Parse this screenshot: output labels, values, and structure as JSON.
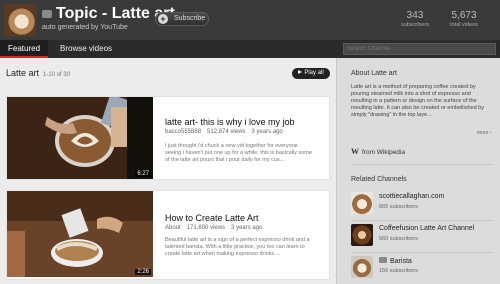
{
  "header": {
    "title": "Topic - Latte art",
    "subtitle": "auto generated by YouTube",
    "subscribe_label": "Subscribe",
    "stats": [
      {
        "value": "343",
        "label": "subscribers"
      },
      {
        "value": "5,673",
        "label": "total videos"
      }
    ]
  },
  "tabs": [
    {
      "label": "Featured",
      "active": true
    },
    {
      "label": "Browse videos",
      "active": false
    }
  ],
  "search": {
    "placeholder": "Search Channel"
  },
  "playlist": {
    "title": "Latte art",
    "count": "1-10 of 30",
    "play_all_label": "Play all",
    "videos": [
      {
        "title": "latte art- this is why i love my job",
        "uploader": "bacco555888",
        "views": "512,874 views",
        "age": "3 years ago",
        "description": "I just thought i'd chuck a new vid together for everyone seeing i haven't put one up for a while, this is basically some of the latte art pours that i pour daily for my cus...",
        "duration": "6:27"
      },
      {
        "title": "How to Create Latte Art",
        "uploader": "About",
        "views": "171,600 views",
        "age": "3 years ago",
        "description": "Beautiful latte art is a sign of a perfect espresso drink and a talented barista. With a little practice, you too can learn to create latte art when making espresso drinks....",
        "duration": "2:26"
      }
    ]
  },
  "sidebar": {
    "about_heading": "About Latte art",
    "about_text": "Latte art is a method of preparing coffee created by pouring steamed milk into a shot of espresso and resulting in a pattern or design on the surface of the resulting latte. It can also be created or embellished by simply \"drawing\" in the top laye...",
    "more_label": "more ›",
    "wiki_label": "from Wikipedia",
    "related_heading": "Related Channels",
    "related": [
      {
        "name": "scottiecallaghan.com",
        "subs": "865 subscribers"
      },
      {
        "name": "Coffeefusion Latte Art Channel",
        "subs": "560 subscribers"
      },
      {
        "name": "Barista",
        "subs": "156 subscribers",
        "yt": true
      }
    ]
  },
  "colors": {
    "header_bg": "#3a3a3a",
    "tab_underline": "#d62c2c",
    "page_bg": "#ececec"
  }
}
